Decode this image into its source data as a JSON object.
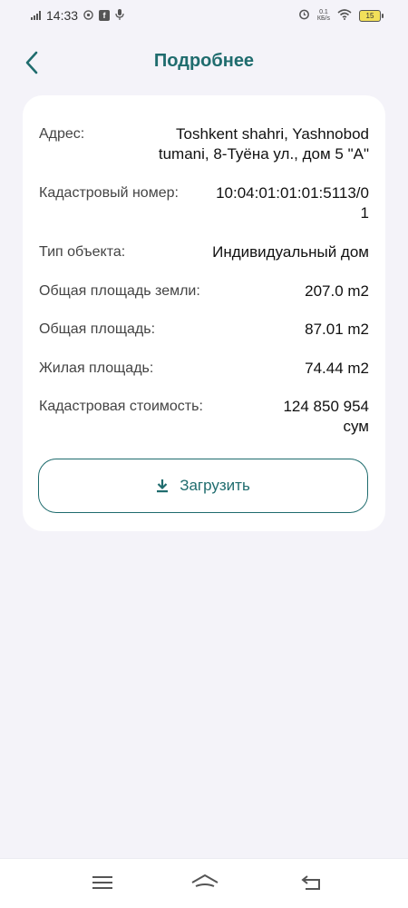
{
  "status_bar": {
    "time": "14:33",
    "net_speed_value": "0.1",
    "net_speed_unit": "КБ/s",
    "battery": "15"
  },
  "header": {
    "title": "Подробнее"
  },
  "details": {
    "address_label": "Адрес:",
    "address_value": "Toshkent shahri, Yashnobod tumani, 8-Туёна ул., дом 5 \"А\"",
    "cadastral_label": "Кадастровый номер:",
    "cadastral_value": "10:04:01:01:01:5113/01",
    "object_type_label": "Тип объекта:",
    "object_type_value": "Индивидуальный дом",
    "land_area_label": "Общая площадь земли:",
    "land_area_value": "207.0 m2",
    "total_area_label": "Общая площадь:",
    "total_area_value": "87.01 m2",
    "living_area_label": "Жилая площадь:",
    "living_area_value": "74.44 m2",
    "cadastral_cost_label": "Кадастровая стоимость:",
    "cadastral_cost_value": "124 850 954 сум"
  },
  "actions": {
    "download_label": "Загрузить"
  },
  "colors": {
    "accent": "#1f6c6e",
    "background": "#f4f3f9",
    "card": "#ffffff"
  }
}
